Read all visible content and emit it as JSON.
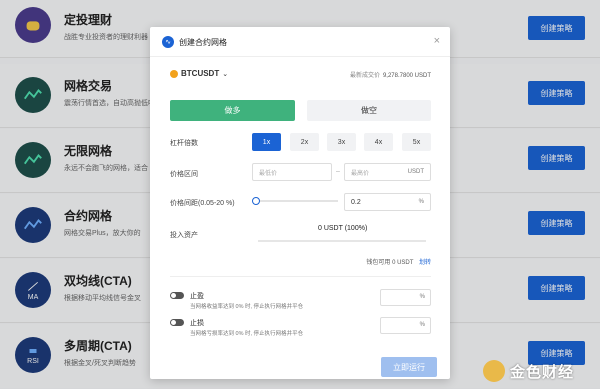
{
  "background_list": [
    {
      "title": "定投理财",
      "desc": "战胜专业投资者的理财利器",
      "button": "创建策略",
      "icon": "pig-icon",
      "color": "#4a3c8c"
    },
    {
      "title": "网格交易",
      "desc": "震荡行情首选，自动高抛低吸",
      "button": "创建策略",
      "icon": "grid-wave-icon",
      "color": "#1e4f4a"
    },
    {
      "title": "无限网格",
      "desc": "永远不会跑飞的网格，适合",
      "button": "创建策略",
      "icon": "infinite-grid-icon",
      "color": "#1e4f4a"
    },
    {
      "title": "合约网格",
      "desc": "网格交易Plus，放大你的",
      "button": "创建策略",
      "icon": "contract-grid-icon",
      "color": "#1d3b7a"
    },
    {
      "title": "双均线(CTA)",
      "desc": "根据移动平均线信号金叉",
      "button": "创建策略",
      "icon": "ma-icon",
      "icon_text": "MA",
      "color": "#1d3b7a"
    },
    {
      "title": "多周期(CTA)",
      "desc": "根据金叉/死叉判断趋势",
      "button": "创建策略",
      "icon": "rsi-icon",
      "icon_text": "RSI",
      "color": "#1d3b7a"
    }
  ],
  "modal": {
    "title": "创建合约网格",
    "close": "×",
    "pair": "BTCUSDT",
    "latest_price_label": "最新成交价",
    "latest_price": "9,278.7800 USDT",
    "long_label": "做多",
    "short_label": "做空",
    "leverage_label": "杠杆倍数",
    "leverage_options": [
      "1x",
      "2x",
      "3x",
      "4x",
      "5x"
    ],
    "leverage_selected": "1x",
    "price_range_label": "价格区间",
    "price_low_placeholder": "最低价",
    "price_high_placeholder": "最高价",
    "range_separator": "–",
    "price_unit": "USDT",
    "grid_gap_label": "价格间距(0.05-20 %)",
    "grid_gap_value": "0.2",
    "percent": "%",
    "invest_label": "投入资产",
    "invest_value": "0 USDT (100%)",
    "available_label": "钱包可用",
    "available_value": "0 USDT",
    "transfer_label": "划转",
    "take_profit_label": "止盈",
    "take_profit_desc": "当网格收益率达到 0% 时, 停止执行网格并平仓",
    "stop_loss_label": "止损",
    "stop_loss_desc": "当网格亏损率达到 0% 时, 停止执行网格并平仓",
    "run_button": "立即运行"
  },
  "watermark": "金色财经",
  "colors": {
    "accent": "#1b63d4",
    "long": "#3fb27d",
    "run_disabled": "#9fbfef"
  }
}
